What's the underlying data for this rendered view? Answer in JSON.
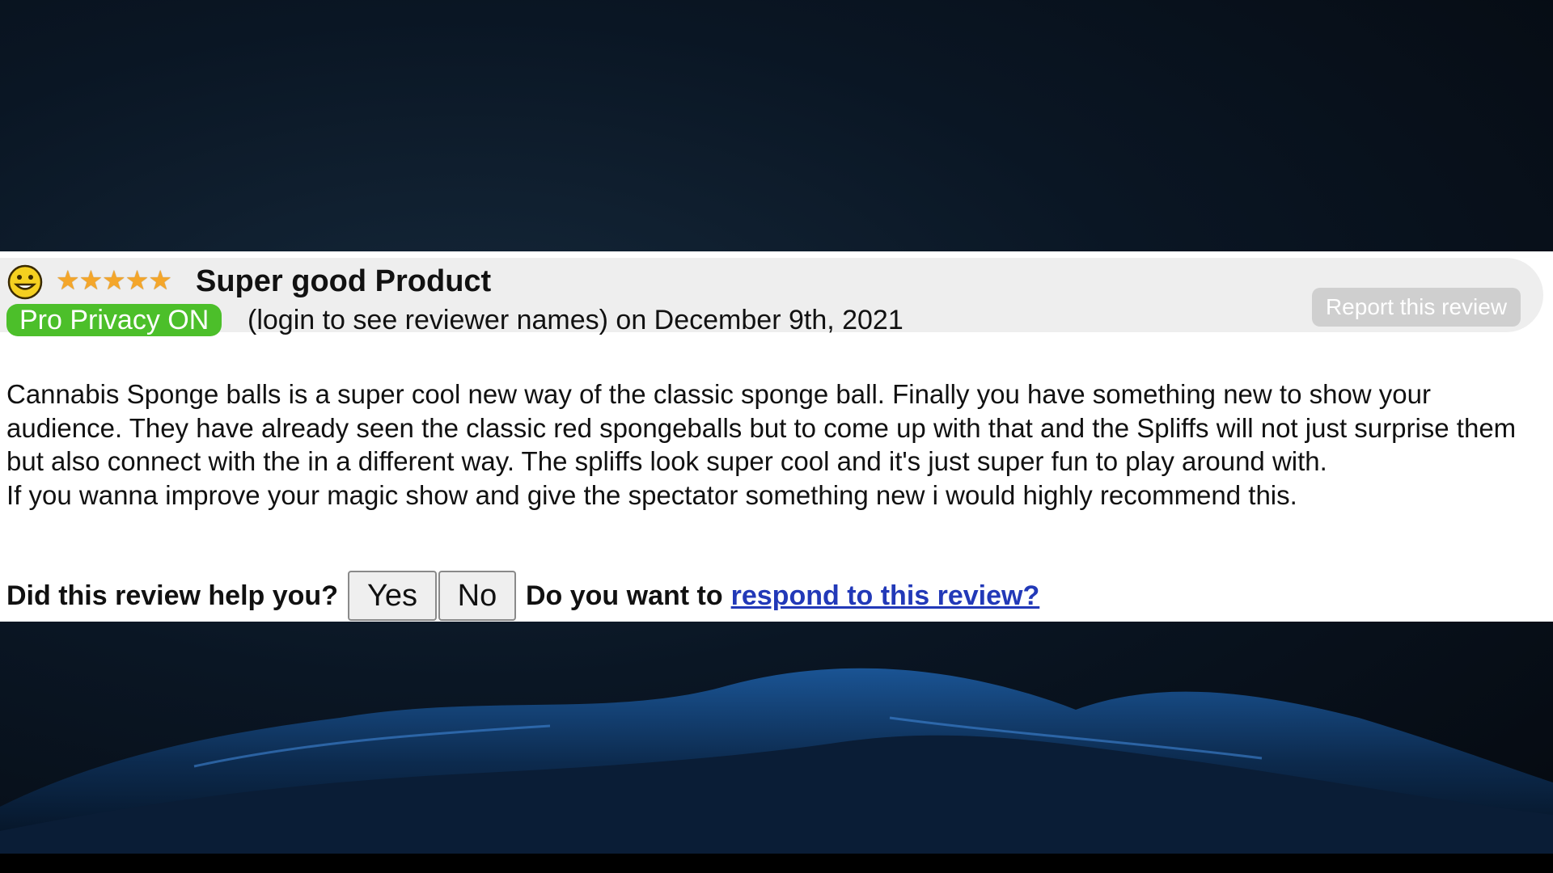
{
  "review": {
    "mood_icon": "smiley-face-icon",
    "rating": {
      "stars": 5,
      "max": 5,
      "glyph": "★★★★★",
      "color": "#f4a62a"
    },
    "title": "Super good Product",
    "privacy_badge": "Pro Privacy ON",
    "meta": "(login to see reviewer names) on December 9th, 2021",
    "report_label": "Report this review",
    "body": {
      "paragraph_1": "Cannabis Sponge balls is a super cool new way of the classic sponge ball. Finally you have something new to show your audience. They have already seen the classic red spongeballs but to come up with that and the Spliffs will not just surprise them but also connect with the in a different way. The spliffs look super cool and it's just super fun to play around with.",
      "paragraph_2": "If you wanna improve your magic show and give the spectator something new i would highly recommend this."
    },
    "feedback": {
      "question": "Did this review help you?",
      "yes_label": "Yes",
      "no_label": "No",
      "respond_prompt": "Do you want to",
      "respond_link": "respond to this review?"
    }
  },
  "colors": {
    "badge_green": "#4cbf2a",
    "link_blue": "#2239b8",
    "header_gray": "#eeeeee",
    "report_gray": "#cfcfcf"
  }
}
